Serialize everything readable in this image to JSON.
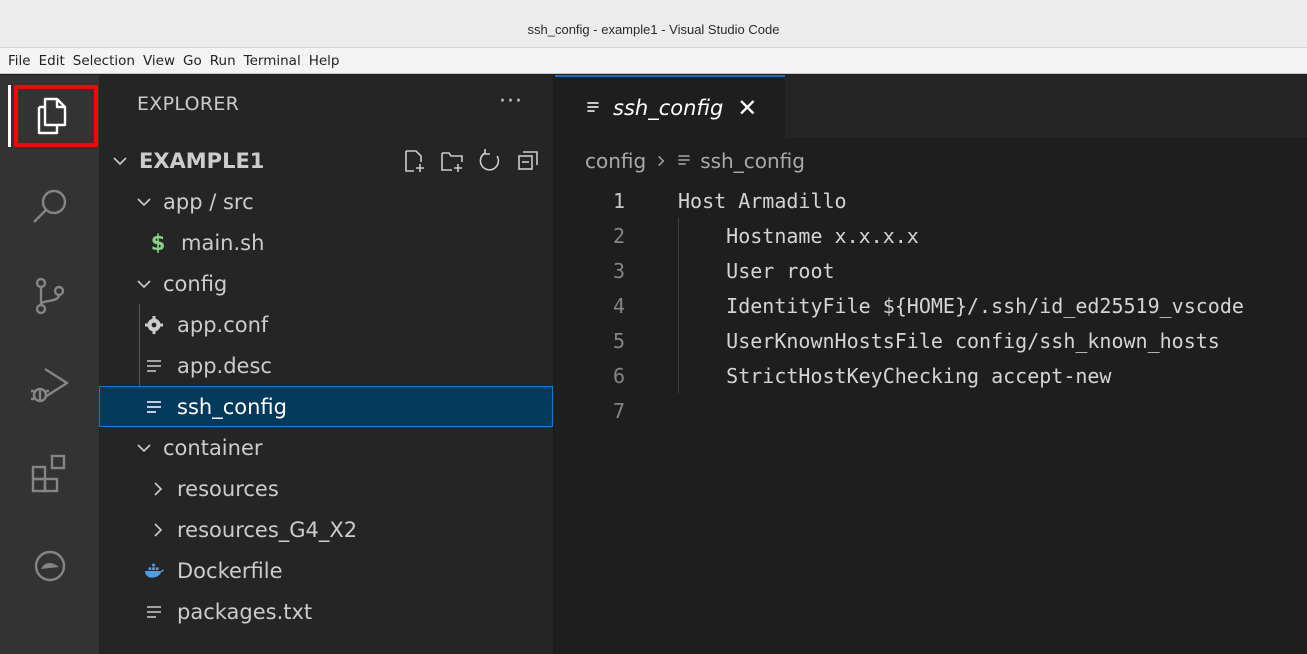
{
  "window": {
    "title": "ssh_config - example1 - Visual Studio Code"
  },
  "menu": [
    "File",
    "Edit",
    "Selection",
    "View",
    "Go",
    "Run",
    "Terminal",
    "Help"
  ],
  "activity_bar": [
    {
      "name": "explorer-icon",
      "active": true
    },
    {
      "name": "search-icon"
    },
    {
      "name": "source-control-icon"
    },
    {
      "name": "run-debug-icon"
    },
    {
      "name": "extensions-icon"
    },
    {
      "name": "remote-explorer-icon"
    }
  ],
  "explorer": {
    "header": "EXPLORER",
    "more": "···",
    "root": "EXAMPLE1",
    "folder_actions": [
      "new-file-icon",
      "new-folder-icon",
      "refresh-icon",
      "collapse-all-icon"
    ],
    "tree": [
      {
        "label": "app / src",
        "type": "folder",
        "expanded": true,
        "depth": 1
      },
      {
        "label": "main.sh",
        "type": "file",
        "icon": "$",
        "depth": 2
      },
      {
        "label": "config",
        "type": "folder",
        "expanded": true,
        "depth": 1
      },
      {
        "label": "app.conf",
        "type": "file",
        "icon": "gear-icon",
        "depth": 2
      },
      {
        "label": "app.desc",
        "type": "file",
        "icon": "lines-icon",
        "depth": 2
      },
      {
        "label": "ssh_config",
        "type": "file",
        "icon": "lines-icon",
        "depth": 2,
        "selected": true
      },
      {
        "label": "container",
        "type": "folder",
        "expanded": true,
        "depth": 1
      },
      {
        "label": "resources",
        "type": "folder",
        "expanded": false,
        "depth": 2
      },
      {
        "label": "resources_G4_X2",
        "type": "folder",
        "expanded": false,
        "depth": 2
      },
      {
        "label": "Dockerfile",
        "type": "file",
        "icon": "docker-icon",
        "depth": 2
      },
      {
        "label": "packages.txt",
        "type": "file",
        "icon": "lines-icon",
        "depth": 2
      }
    ]
  },
  "editor": {
    "tab": {
      "label": "ssh_config",
      "close": "✕"
    },
    "breadcrumb": {
      "folder": "config",
      "file": "ssh_config"
    },
    "lines": [
      {
        "n": "1",
        "text": "Host Armadillo"
      },
      {
        "n": "2",
        "text": "    Hostname x.x.x.x"
      },
      {
        "n": "3",
        "text": "    User root"
      },
      {
        "n": "4",
        "text": "    IdentityFile ${HOME}/.ssh/id_ed25519_vscode"
      },
      {
        "n": "5",
        "text": "    UserKnownHostsFile config/ssh_known_hosts"
      },
      {
        "n": "6",
        "text": "    StrictHostKeyChecking accept-new"
      },
      {
        "n": "7",
        "text": ""
      }
    ],
    "active_line": "1"
  }
}
